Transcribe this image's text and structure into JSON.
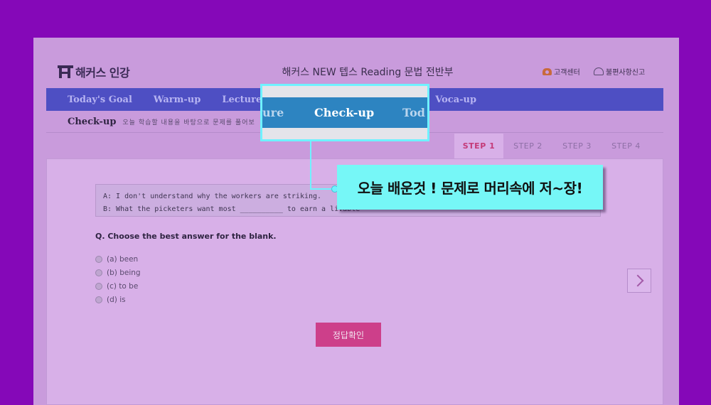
{
  "header": {
    "logo_text": "해커스 인강",
    "course_title": "해커스 NEW 텝스 Reading 문법 전반부",
    "customer_center": "고객센터",
    "report": "불편사항신고"
  },
  "nav": {
    "items": [
      "Today's Goal",
      "Warm-up",
      "Lecture",
      "",
      "",
      "Voca-up"
    ]
  },
  "subheader": {
    "title": "Check-up",
    "description": "오늘 학습할 내용을 바탕으로 문제를 풀어보"
  },
  "steps": [
    {
      "label": "STEP 1",
      "active": true
    },
    {
      "label": "STEP 2",
      "active": false
    },
    {
      "label": "STEP 3",
      "active": false
    },
    {
      "label": "STEP 4",
      "active": false
    }
  ],
  "dialog": {
    "line_a": "A: I don't understand why the workers are striking.",
    "line_b": "B: What the picketers want most __________ to earn a livable"
  },
  "question": "Q. Choose the best answer for the blank.",
  "options": [
    "(a) been",
    "(b) being",
    "(c) to be",
    "(d) is"
  ],
  "submit_label": "정답확인",
  "zoom": {
    "left_fragment": "ure",
    "center": "Check-up",
    "right_fragment": "Tod"
  },
  "callout_text": "오늘 배운것 ! 문제로 머리속에 저~장!",
  "colors": {
    "page_bg": "#8508b8",
    "nav_bg": "#4e4fc3",
    "accent": "#cd3f8a",
    "callout_bg": "#76f7f7",
    "zoom_band": "#2d84c1"
  }
}
